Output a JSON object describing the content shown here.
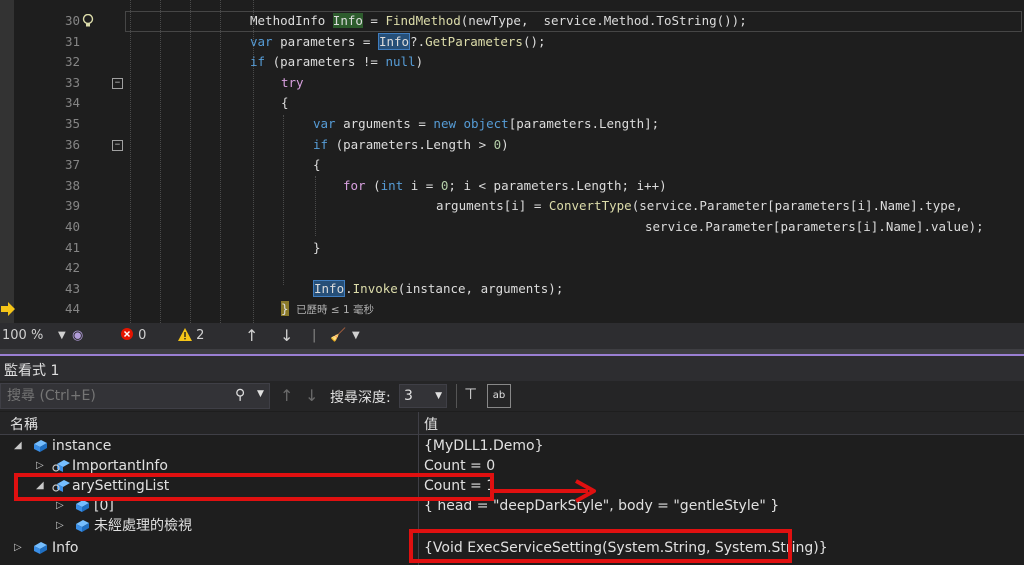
{
  "editor": {
    "lines": [
      {
        "num": "30",
        "segments": [
          [
            "",
            "MethodInfo"
          ],
          [
            "",
            " "
          ],
          [
            "hlword2",
            "Info"
          ],
          [
            "",
            " = "
          ],
          [
            "fn",
            "FindMethod"
          ],
          [
            "",
            "(newType,  service.Method.ToString());"
          ]
        ]
      },
      {
        "num": "31",
        "segments": [
          [
            "kw",
            "var"
          ],
          [
            "",
            " parameters = "
          ],
          [
            "hlword",
            "Info"
          ],
          [
            "",
            "?."
          ],
          [
            "fn",
            "GetParameters"
          ],
          [
            "",
            "();"
          ]
        ]
      },
      {
        "num": "32",
        "segments": [
          [
            "kw",
            "if"
          ],
          [
            "",
            " (parameters != "
          ],
          [
            "kw",
            "null"
          ],
          [
            "",
            ")"
          ]
        ]
      },
      {
        "num": "33",
        "segments": [
          [
            "ct",
            "try"
          ]
        ]
      },
      {
        "num": "34",
        "segments": [
          [
            "",
            "{"
          ]
        ]
      },
      {
        "num": "35",
        "segments": [
          [
            "kw",
            "var"
          ],
          [
            "",
            " arguments = "
          ],
          [
            "kw",
            "new"
          ],
          [
            "",
            " "
          ],
          [
            "kw",
            "object"
          ],
          [
            "",
            "[parameters.Length];"
          ]
        ]
      },
      {
        "num": "36",
        "segments": [
          [
            "kw",
            "if"
          ],
          [
            "",
            " (parameters.Length > "
          ],
          [
            "nu",
            "0"
          ],
          [
            "",
            ")"
          ]
        ]
      },
      {
        "num": "37",
        "segments": [
          [
            "",
            "{"
          ]
        ]
      },
      {
        "num": "38",
        "segments": [
          [
            "ct",
            "for"
          ],
          [
            "",
            " ("
          ],
          [
            "kw",
            "int"
          ],
          [
            "",
            " i = "
          ],
          [
            "nu",
            "0"
          ],
          [
            "",
            "; i < parameters.Length; i++)"
          ]
        ]
      },
      {
        "num": "39",
        "segments": [
          [
            "",
            "arguments[i] = "
          ],
          [
            "fn",
            "ConvertType"
          ],
          [
            "",
            "(service.Parameter[parameters[i].Name].type,"
          ]
        ]
      },
      {
        "num": "40",
        "segments": [
          [
            "",
            "service.Parameter[parameters[i].Name].value);"
          ]
        ]
      },
      {
        "num": "41",
        "segments": [
          [
            "",
            "}"
          ]
        ]
      },
      {
        "num": "42",
        "segments": []
      },
      {
        "num": "43",
        "segments": [
          [
            "hlword",
            "Info"
          ],
          [
            "",
            "."
          ],
          [
            "fn",
            "Invoke"
          ],
          [
            "",
            "(instance, arguments);"
          ]
        ]
      },
      {
        "num": "44",
        "segments": [
          [
            "bracehl",
            "}"
          ],
          [
            "",
            " "
          ],
          [
            "tip",
            "已歷時 ≤ 1 毫秒"
          ]
        ]
      }
    ]
  },
  "statusbar": {
    "zoom": "100 %",
    "errors": "0",
    "warnings": "2"
  },
  "watch": {
    "title": "監看式 1",
    "search_placeholder": "搜尋 (Ctrl+E)",
    "depth_label": "搜尋深度:",
    "depth_value": "3",
    "col_name": "名稱",
    "col_value": "值",
    "rows": [
      {
        "name": "instance",
        "value": "{MyDLL1.Demo}"
      },
      {
        "name": "ImportantInfo",
        "value": "Count = 0"
      },
      {
        "name": "arySettingList",
        "value": "Count = 1"
      },
      {
        "name": "[0]",
        "value": "{ head = \"deepDarkStyle\", body = \"gentleStyle\" }"
      },
      {
        "name": "未經處理的檢視",
        "value": ""
      },
      {
        "name": "Info",
        "value": "{Void ExecServiceSetting(System.String, System.String)}"
      }
    ]
  },
  "colors": {
    "annotation_red": "#e01010",
    "accent_purple": "#9a7fd3"
  }
}
